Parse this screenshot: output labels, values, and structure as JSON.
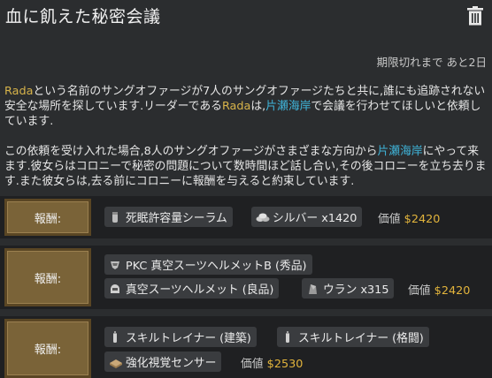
{
  "quest": {
    "title": "血に飢えた秘密会議",
    "expiry": "期限切れまで あと2日",
    "description": {
      "p1_a": "Rada",
      "p1_b": "という名前のサングオファージが7人のサングオファージたちと共に,誰にも追跡されない安全な場所を探しています.リーダーである",
      "p1_c": "Rada",
      "p1_d": "は,",
      "p1_e": "片瀬海岸",
      "p1_f": "で会議を行わせてほしいと依頼しています.",
      "p2_a": "この依頼を受け入れた場合,8人のサングオファージがさまざまな方向から",
      "p2_b": "片瀬海岸",
      "p2_c": "にやって来ます.彼女らはコロニーで秘密の問題について数時間ほど話し合い,その後コロニーを立ち去ります.また彼女らは,去る前にコロニーに報酬を与えると約束しています."
    }
  },
  "rewards": [
    {
      "button_label": "報酬:",
      "items": [
        {
          "label": "死眠許容量シーラム",
          "icon": "serum-icon"
        },
        {
          "label": "シルバー x1420",
          "icon": "silver-icon"
        }
      ],
      "value_label": "価値",
      "value_amount": "$2420"
    },
    {
      "button_label": "報酬:",
      "items": [
        {
          "label": "PKC 真空スーツヘルメットB (秀品)",
          "icon": "helmet-b-icon"
        },
        {
          "label": "真空スーツヘルメット (良品)",
          "icon": "helmet-icon"
        },
        {
          "label": "ウラン x315",
          "icon": "uranium-icon"
        }
      ],
      "value_label": "価値",
      "value_amount": "$2420"
    },
    {
      "button_label": "報酬:",
      "items": [
        {
          "label": "スキルトレイナー (建築)",
          "icon": "neurotrainer-icon"
        },
        {
          "label": "スキルトレイナー (格闘)",
          "icon": "neurotrainer-icon"
        },
        {
          "label": "強化視覚センサー",
          "icon": "sensor-icon"
        }
      ],
      "value_label": "価値",
      "value_amount": "$2530"
    }
  ],
  "colors": {
    "background": "#2b2d2f",
    "highlight_name": "#d8b44a",
    "highlight_place": "#3fb3d8",
    "value_amount": "#e2b43c",
    "reward_button": "#7a6338"
  }
}
